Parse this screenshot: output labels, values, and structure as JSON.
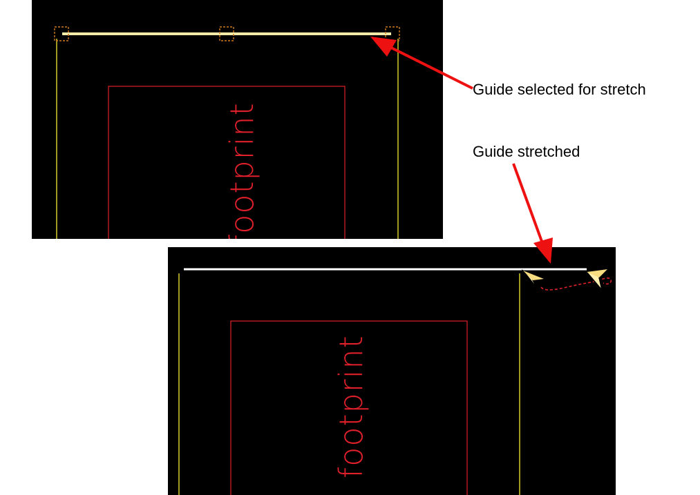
{
  "top_view": {
    "footprint_label": "footprint"
  },
  "bottom_view": {
    "footprint_label": "footprint"
  },
  "callouts": {
    "selected": "Guide selected for stretch",
    "stretched": "Guide stretched"
  },
  "colors": {
    "canvas_bg": "#000000",
    "guide_line": "#f5eba8",
    "boundary_line": "#a09a20",
    "footprint": "#e0202a",
    "handle": "#d07a20",
    "callout_arrow": "#ee1111"
  },
  "icons": [
    "grip-handle-icon",
    "cursor-arrow-icon",
    "drag-path-icon",
    "callout-arrow-icon"
  ]
}
